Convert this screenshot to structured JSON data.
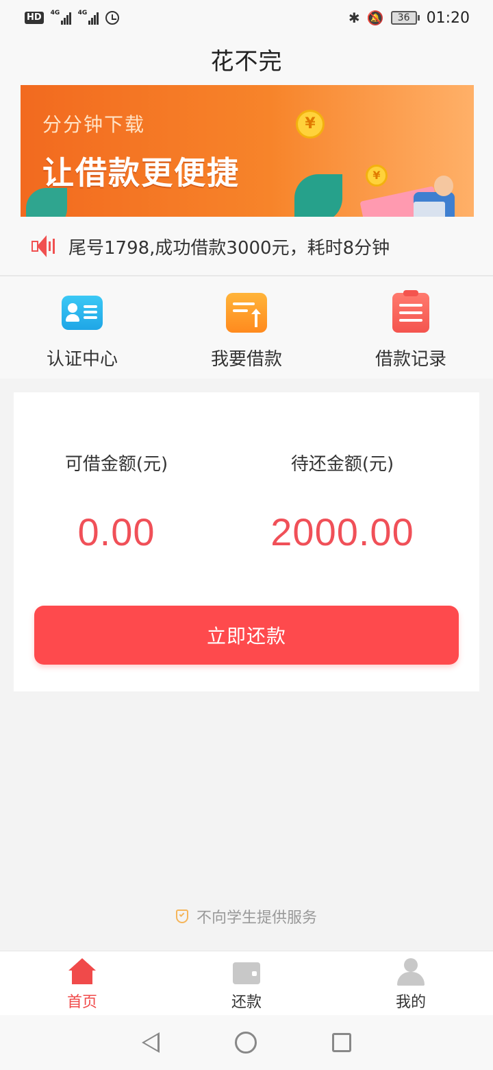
{
  "status_bar": {
    "hd": "HD",
    "signal1_label": "4G",
    "signal2_label": "4G",
    "battery": "36",
    "time": "01:20"
  },
  "header": {
    "title": "花不完"
  },
  "banner": {
    "subtitle": "分分钟下载",
    "headline": "让借款更便捷",
    "coin_symbol": "¥"
  },
  "notice": {
    "text": "尾号1798,成功借款3000元，耗时8分钟"
  },
  "quick_menu": [
    {
      "label": "认证中心",
      "icon": "id-card-icon"
    },
    {
      "label": "我要借款",
      "icon": "borrow-icon"
    },
    {
      "label": "借款记录",
      "icon": "record-icon"
    }
  ],
  "amounts": {
    "available_label": "可借金额(元)",
    "available_value": "0.00",
    "pending_label": "待还金额(元)",
    "pending_value": "2000.00"
  },
  "repay_button": "立即还款",
  "footer_note": "不向学生提供服务",
  "tabs": [
    {
      "label": "首页",
      "active": true
    },
    {
      "label": "还款",
      "active": false
    },
    {
      "label": "我的",
      "active": false
    }
  ],
  "colors": {
    "accent_red": "#fe4a4d",
    "amount_red": "#f05058",
    "banner_orange": "#f26a1f",
    "active_tab": "#f04a4a"
  }
}
